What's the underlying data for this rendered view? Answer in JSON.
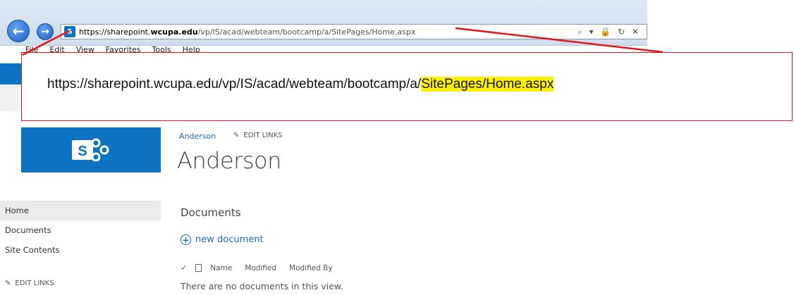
{
  "browser": {
    "url_scheme": "https://",
    "url_host_sub": "sharepoint.",
    "url_host_domain": "wcupa.edu",
    "url_path": "/vp/IS/acad/webteam/bootcamp/a/SitePages/Home.aspx",
    "addr_icons": "⌕ ▾ 🔒 ↻ ✕",
    "menu_items": [
      "File",
      "Edit",
      "View",
      "Favorites",
      "Tools",
      "Help"
    ]
  },
  "callout": {
    "url_prefix": "https://sharepoint.wcupa.edu/vp/IS/acad/webteam/bootcamp/a/",
    "url_highlight": "SitePages/Home.aspx",
    "highlight_color": "#fff200",
    "border_color": "#e0161b"
  },
  "site": {
    "breadcrumb": "Anderson",
    "edit_links": "EDIT LINKS",
    "title": "Anderson",
    "brand_color": "#0b72c4"
  },
  "quicklaunch": {
    "items": [
      "Home",
      "Documents",
      "Site Contents"
    ],
    "selected": "Home",
    "edit_links": "EDIT LINKS"
  },
  "library": {
    "heading": "Documents",
    "new_label": "new document",
    "columns": [
      "Name",
      "Modified",
      "Modified By"
    ],
    "empty_message": "There are no documents in this view."
  }
}
